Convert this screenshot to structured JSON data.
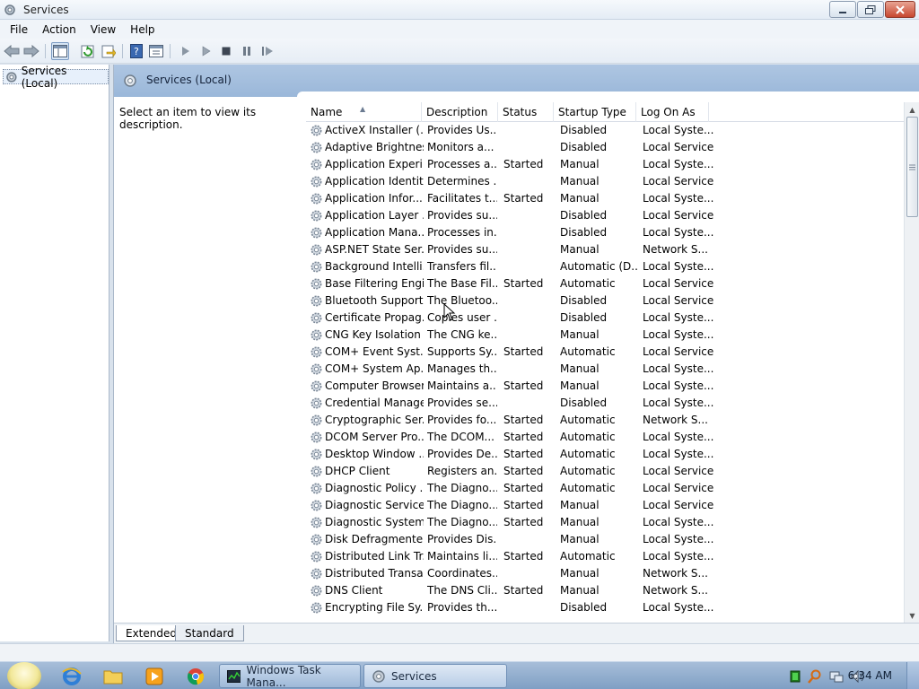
{
  "window": {
    "title": "Services"
  },
  "menu": [
    "File",
    "Action",
    "View",
    "Help"
  ],
  "tree": {
    "item": "Services (Local)"
  },
  "pane": {
    "header": "Services (Local)",
    "description_prompt": "Select an item to view its description."
  },
  "columns": [
    "Name",
    "Description",
    "Status",
    "Startup Type",
    "Log On As"
  ],
  "rows": [
    {
      "name": "ActiveX Installer (...",
      "desc": "Provides Us...",
      "status": "",
      "startup": "Disabled",
      "logon": "Local Syste..."
    },
    {
      "name": "Adaptive Brightness",
      "desc": "Monitors a...",
      "status": "",
      "startup": "Disabled",
      "logon": "Local Service"
    },
    {
      "name": "Application Experi...",
      "desc": "Processes a...",
      "status": "Started",
      "startup": "Manual",
      "logon": "Local Syste..."
    },
    {
      "name": "Application Identity",
      "desc": "Determines ...",
      "status": "",
      "startup": "Manual",
      "logon": "Local Service"
    },
    {
      "name": "Application Infor...",
      "desc": "Facilitates t...",
      "status": "Started",
      "startup": "Manual",
      "logon": "Local Syste..."
    },
    {
      "name": "Application Layer ...",
      "desc": "Provides su...",
      "status": "",
      "startup": "Disabled",
      "logon": "Local Service"
    },
    {
      "name": "Application Mana...",
      "desc": "Processes in...",
      "status": "",
      "startup": "Disabled",
      "logon": "Local Syste..."
    },
    {
      "name": "ASP.NET State Ser...",
      "desc": "Provides su...",
      "status": "",
      "startup": "Manual",
      "logon": "Network S..."
    },
    {
      "name": "Background Intelli...",
      "desc": "Transfers fil...",
      "status": "",
      "startup": "Automatic (D...",
      "logon": "Local Syste..."
    },
    {
      "name": "Base Filtering Engi...",
      "desc": "The Base Fil...",
      "status": "Started",
      "startup": "Automatic",
      "logon": "Local Service"
    },
    {
      "name": "Bluetooth Support...",
      "desc": "The Bluetoo...",
      "status": "",
      "startup": "Disabled",
      "logon": "Local Service"
    },
    {
      "name": "Certificate Propag...",
      "desc": "Copies user ...",
      "status": "",
      "startup": "Disabled",
      "logon": "Local Syste..."
    },
    {
      "name": "CNG Key Isolation",
      "desc": "The CNG ke...",
      "status": "",
      "startup": "Manual",
      "logon": "Local Syste..."
    },
    {
      "name": "COM+ Event Syst...",
      "desc": "Supports Sy...",
      "status": "Started",
      "startup": "Automatic",
      "logon": "Local Service"
    },
    {
      "name": "COM+ System Ap...",
      "desc": "Manages th...",
      "status": "",
      "startup": "Manual",
      "logon": "Local Syste..."
    },
    {
      "name": "Computer Browser",
      "desc": "Maintains a...",
      "status": "Started",
      "startup": "Manual",
      "logon": "Local Syste..."
    },
    {
      "name": "Credential Manager",
      "desc": "Provides se...",
      "status": "",
      "startup": "Disabled",
      "logon": "Local Syste..."
    },
    {
      "name": "Cryptographic Ser...",
      "desc": "Provides fo...",
      "status": "Started",
      "startup": "Automatic",
      "logon": "Network S..."
    },
    {
      "name": "DCOM Server Pro...",
      "desc": "The DCOM...",
      "status": "Started",
      "startup": "Automatic",
      "logon": "Local Syste..."
    },
    {
      "name": "Desktop Window ...",
      "desc": "Provides De...",
      "status": "Started",
      "startup": "Automatic",
      "logon": "Local Syste..."
    },
    {
      "name": "DHCP Client",
      "desc": "Registers an...",
      "status": "Started",
      "startup": "Automatic",
      "logon": "Local Service"
    },
    {
      "name": "Diagnostic Policy ...",
      "desc": "The Diagno...",
      "status": "Started",
      "startup": "Automatic",
      "logon": "Local Service"
    },
    {
      "name": "Diagnostic Service...",
      "desc": "The Diagno...",
      "status": "Started",
      "startup": "Manual",
      "logon": "Local Service"
    },
    {
      "name": "Diagnostic System...",
      "desc": "The Diagno...",
      "status": "Started",
      "startup": "Manual",
      "logon": "Local Syste..."
    },
    {
      "name": "Disk Defragmenter",
      "desc": "Provides Dis...",
      "status": "",
      "startup": "Manual",
      "logon": "Local Syste..."
    },
    {
      "name": "Distributed Link Tr...",
      "desc": "Maintains li...",
      "status": "Started",
      "startup": "Automatic",
      "logon": "Local Syste..."
    },
    {
      "name": "Distributed Transa...",
      "desc": "Coordinates...",
      "status": "",
      "startup": "Manual",
      "logon": "Network S..."
    },
    {
      "name": "DNS Client",
      "desc": "The DNS Cli...",
      "status": "Started",
      "startup": "Manual",
      "logon": "Network S..."
    },
    {
      "name": "Encrypting File Sy...",
      "desc": "Provides th...",
      "status": "",
      "startup": "Disabled",
      "logon": "Local Syste..."
    }
  ],
  "tabs": [
    "Extended",
    "Standard"
  ],
  "taskbar": {
    "tasks": [
      "Windows Task Mana...",
      "Services"
    ],
    "clock": "6:34 AM"
  },
  "colors": {
    "header_bg": "#9ab7d9",
    "taskbar_bg": "#8eaad0"
  }
}
